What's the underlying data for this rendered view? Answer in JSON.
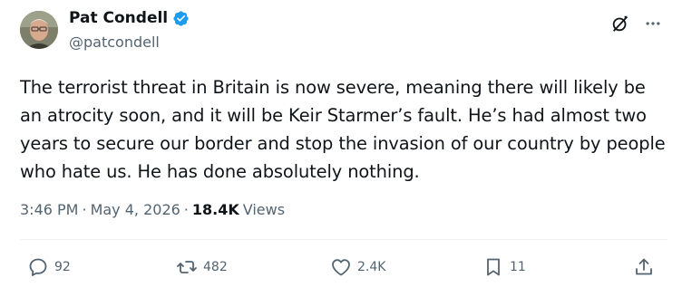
{
  "author": {
    "display_name": "Pat Condell",
    "handle": "@patcondell"
  },
  "tweet": {
    "text": "The terrorist threat in Britain is now severe, meaning there will likely be an atrocity soon, and it will be Keir Starmer’s fault. He’s had almost two years to secure our border and stop the invasion of our country by people who hate us. He has done absolutely nothing.",
    "time": "3:46 PM",
    "date": "May 4, 2026",
    "separator": "·",
    "views_count": "18.4K",
    "views_label": "Views"
  },
  "actions": {
    "replies": "92",
    "reposts": "482",
    "likes": "2.4K",
    "bookmarks": "11"
  },
  "icons": {
    "verified": "verified-badge-icon",
    "grok": "grok-icon",
    "more": "more-icon",
    "reply": "reply-icon",
    "repost": "repost-icon",
    "like": "like-icon",
    "bookmark": "bookmark-icon",
    "share": "share-icon"
  },
  "colors": {
    "verified": "#1d9bf0",
    "text": "#0f1419",
    "secondary": "#536471"
  }
}
